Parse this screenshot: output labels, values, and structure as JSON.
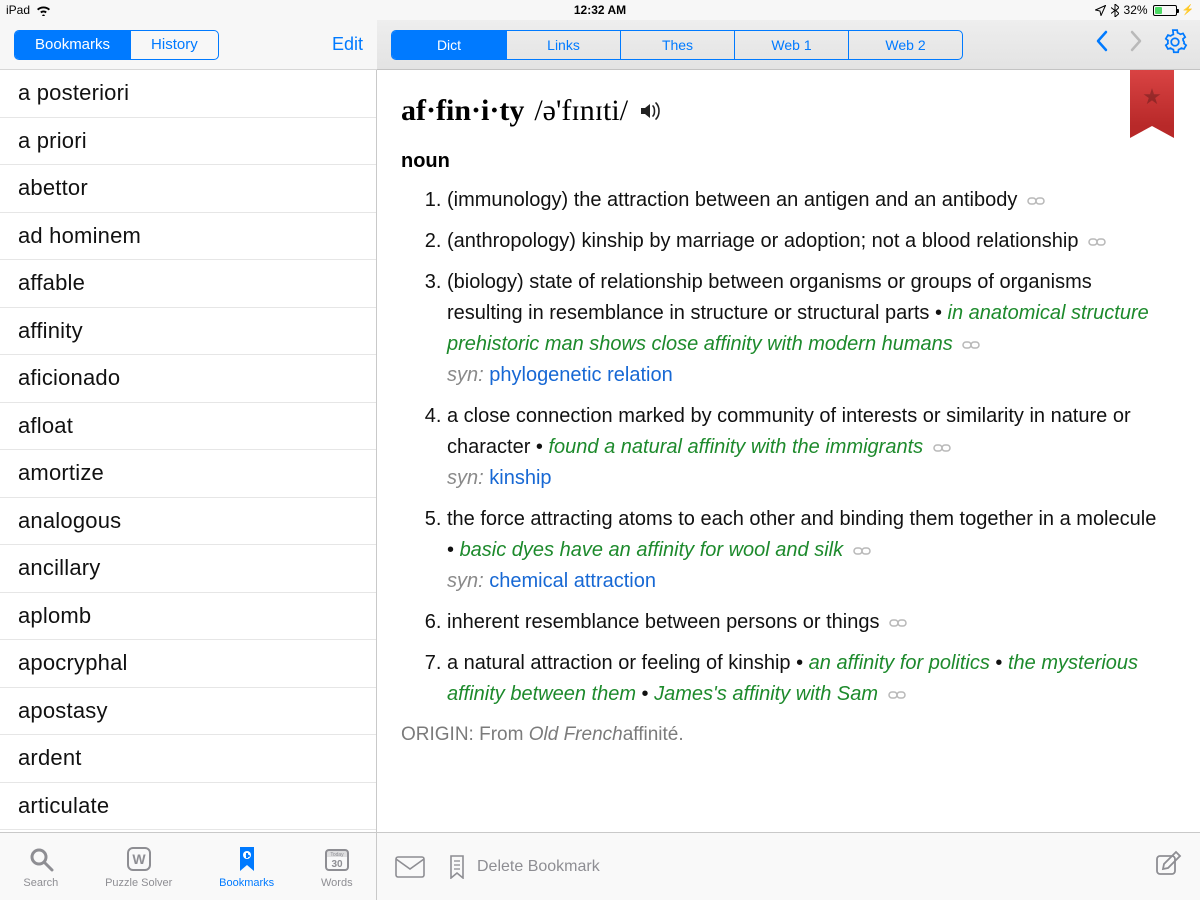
{
  "status": {
    "carrier": "iPad",
    "time": "12:32 AM",
    "battery_pct": "32%"
  },
  "leftTop": {
    "seg_bookmarks": "Bookmarks",
    "seg_history": "History",
    "edit": "Edit"
  },
  "rightTop": {
    "tabs": [
      "Dict",
      "Links",
      "Thes",
      "Web 1",
      "Web 2"
    ]
  },
  "words": [
    "a posteriori",
    "a priori",
    "abettor",
    "ad hominem",
    "affable",
    "affinity",
    "aficionado",
    "afloat",
    "amortize",
    "analogous",
    "ancillary",
    "aplomb",
    "apocryphal",
    "apostasy",
    "ardent",
    "articulate"
  ],
  "entry": {
    "headword": "af·fin·i·ty",
    "pron": "/ə'fɪnɪti/",
    "pos": "noun",
    "defs": [
      {
        "text": "(immunology) the attraction between an antigen and an antibody",
        "link": true
      },
      {
        "text": "(anthropology) kinship by marriage or adoption; not a blood relationship",
        "link": true
      },
      {
        "text": "(biology) state of relationship between organisms or groups of organisms resulting in resemblance in structure or structural parts",
        "examples": [
          "in anatomical structure prehistoric man shows close affinity with modern humans"
        ],
        "link": true,
        "syn": "phylogenetic relation"
      },
      {
        "text": "a close connection marked by community of interests or similarity in nature or character",
        "examples": [
          "found a natural affinity with the immigrants"
        ],
        "link": true,
        "syn": "kinship"
      },
      {
        "text": "the force attracting atoms to each other and binding them together in a molecule",
        "examples": [
          "basic dyes have an affinity for wool and silk"
        ],
        "link": true,
        "syn": "chemical attraction"
      },
      {
        "text": "inherent resemblance between persons or things",
        "link": true
      },
      {
        "text": "a natural attraction or feeling of kinship",
        "examples": [
          "an affinity for politics",
          "the mysterious affinity between them",
          "James's affinity with Sam"
        ],
        "link": true
      }
    ],
    "origin_label": "ORIGIN: From ",
    "origin_lang": "Old French",
    "origin_word": "affinité."
  },
  "synlabel": "syn:",
  "bottomTabs": {
    "search": "Search",
    "puzzle": "Puzzle Solver",
    "bookmarks": "Bookmarks",
    "words": "Words",
    "words_day": "30",
    "words_today": "Today"
  },
  "bottomRight": {
    "delete": "Delete Bookmark"
  }
}
